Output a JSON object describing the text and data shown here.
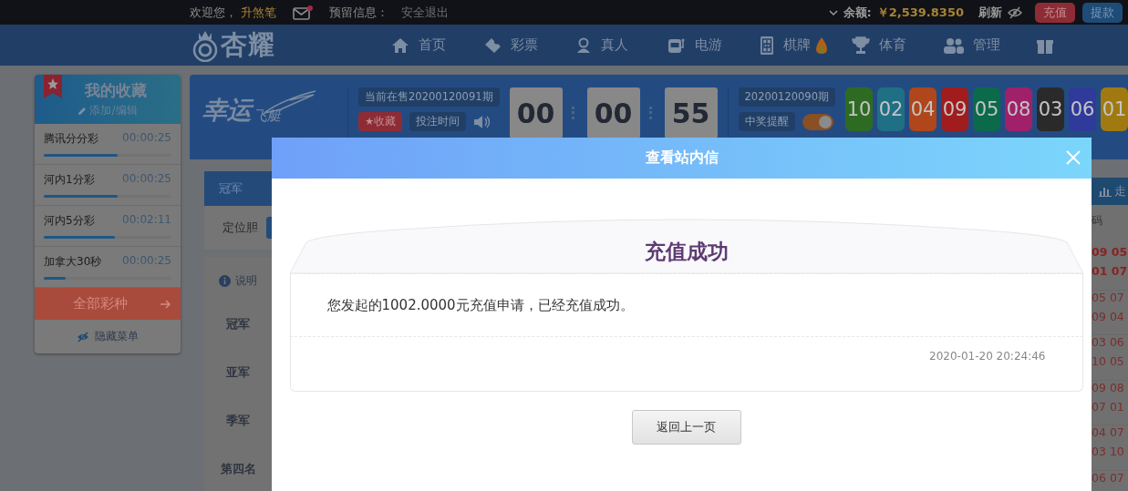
{
  "top_bar": {
    "welcome": "欢迎您，",
    "username": "升煞笔",
    "mail_unread": true,
    "reserved_label": "预留信息：",
    "logout": "安全退出",
    "balance_label": "余额:",
    "balance": "￥2,539.8350",
    "refresh": "刷新",
    "deposit": "充值",
    "withdraw": "提款"
  },
  "nav": {
    "logo": "杏耀",
    "items": [
      {
        "label": "首页",
        "kind": "home"
      },
      {
        "label": "彩票",
        "kind": "ticket"
      },
      {
        "label": "真人",
        "kind": "person"
      },
      {
        "label": "电游",
        "kind": "slot"
      },
      {
        "label": "棋牌",
        "kind": "tile"
      },
      {
        "label": "体育",
        "kind": "trophy"
      },
      {
        "label": "管理",
        "kind": "users"
      },
      {
        "kind": "gift"
      }
    ]
  },
  "favorites": {
    "title": "我的收藏",
    "edit": "添加/编辑",
    "items": [
      {
        "name": "腾讯分分彩",
        "time": "00:00:25",
        "level": 0.58
      },
      {
        "name": "河内1分彩",
        "time": "00:00:25",
        "level": 0.58
      },
      {
        "name": "河内5分彩",
        "time": "00:02:11",
        "level": 0.56
      },
      {
        "name": "加拿大30秒",
        "time": "00:00:25",
        "level": 0.17
      }
    ],
    "all_button": "全部彩种",
    "hide_menu": "隐藏菜单"
  },
  "game": {
    "logo": "幸运",
    "logo_sub": "飞艇",
    "current_issue": "当前在售20200120091期",
    "favorite": "★收藏",
    "bet_time": "投注时间",
    "countdown": [
      "00",
      "00",
      "55"
    ],
    "last_issue": "20200120090期",
    "reminder": "中奖提醒",
    "reminder_on": true,
    "balls": [
      {
        "number": "10",
        "color": "#2e6b22"
      },
      {
        "number": "02",
        "color": "#1f6f85"
      },
      {
        "number": "04",
        "color": "#b0461b"
      },
      {
        "number": "09",
        "color": "#a11c1c"
      },
      {
        "number": "05",
        "color": "#0a6a4a"
      },
      {
        "number": "08",
        "color": "#a0206a"
      },
      {
        "number": "03",
        "color": "#2a2a2a"
      },
      {
        "number": "06",
        "color": "#2f3a9a"
      },
      {
        "number": "01",
        "color": "#a07a10"
      }
    ]
  },
  "bet_panel": {
    "tab": "冠军",
    "sub_tab": "定位胆",
    "info": "说明",
    "positions": [
      "冠军",
      "亚军",
      "季军",
      "第四名"
    ]
  },
  "history": {
    "tab": "走",
    "column": "码",
    "rows": [
      {
        "numbers": [
          "09 05",
          "01 07"
        ],
        "latest": true
      },
      {
        "numbers": [
          "05 07",
          "09 04"
        ],
        "latest": false
      },
      {
        "numbers": [
          "03 06",
          "10 05"
        ],
        "latest": false
      },
      {
        "numbers": [
          "09 08",
          "07 01"
        ],
        "latest": false
      },
      {
        "numbers": [
          "04 07",
          "03 10"
        ],
        "latest": false
      },
      {
        "numbers": [
          "06 07"
        ],
        "latest": false
      }
    ]
  },
  "modal": {
    "title": "查看站内信",
    "heading": "充值成功",
    "message": "您发起的1002.0000元充值申请，已经充值成功。",
    "date": "2020-01-20 20:24:46",
    "back_button": "返回上一页"
  }
}
